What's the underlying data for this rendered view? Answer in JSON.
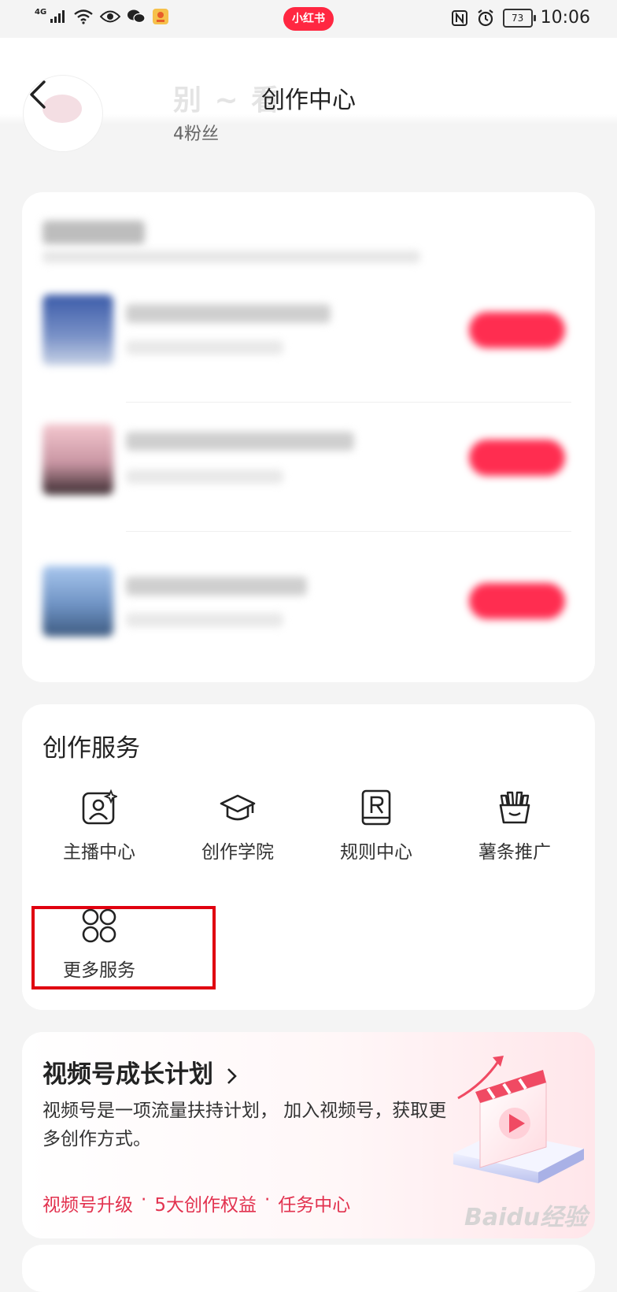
{
  "status_bar": {
    "network": "4G",
    "app_badge": "小红书",
    "battery": "73",
    "time": "10:06"
  },
  "header": {
    "title": "创作中心",
    "profile_name": "别 ~ 看",
    "fans": "4粉丝"
  },
  "services": {
    "title": "创作服务",
    "items": [
      {
        "label": "主播中心",
        "icon": "anchor-profile-icon"
      },
      {
        "label": "创作学院",
        "icon": "graduation-cap-icon"
      },
      {
        "label": "规则中心",
        "icon": "rules-book-icon"
      },
      {
        "label": "薯条推广",
        "icon": "fries-icon"
      },
      {
        "label": "更多服务",
        "icon": "four-circles-icon"
      }
    ]
  },
  "growth": {
    "title": "视频号成长计划",
    "description": "视频号是一项流量扶持计划， 加入视频号，获取更多创作方式。",
    "links": [
      "视频号升级",
      "5大创作权益",
      "任务中心"
    ],
    "separator": "·"
  },
  "colors": {
    "accent": "#ff2741",
    "link": "#e2324f",
    "highlight": "#e00010"
  },
  "watermark": "Baidu经验"
}
